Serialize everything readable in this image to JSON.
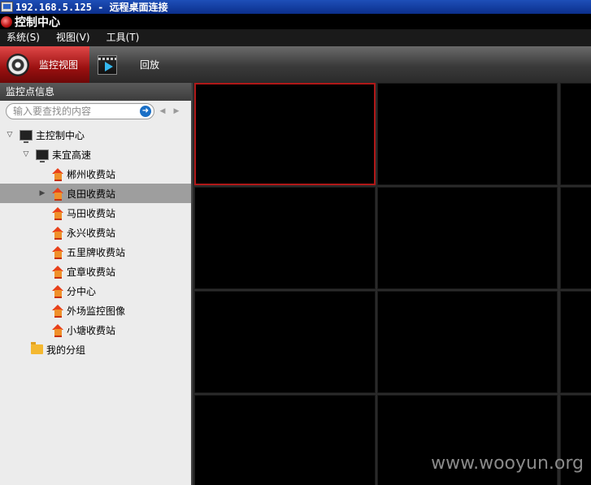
{
  "rdp": {
    "title": "192.168.5.125 - 远程桌面连接"
  },
  "app": {
    "title": "控制中心"
  },
  "menu": [
    "系统(S)",
    "视图(V)",
    "工具(T)"
  ],
  "toolbar": {
    "live_label": "监控视图",
    "playback_label": "回放"
  },
  "panel": {
    "header": "监控点信息",
    "search_placeholder": "输入要查找的内容"
  },
  "tree": [
    {
      "label": "主控制中心",
      "level": 0,
      "icon": "monitor-icon",
      "expander": "▽"
    },
    {
      "label": "耒宜高速",
      "level": 1,
      "icon": "monitor-icon",
      "expander": "▽"
    },
    {
      "label": "郴州收费站",
      "level": 2,
      "icon": "house-icon",
      "expander": ""
    },
    {
      "label": "良田收费站",
      "level": 2,
      "icon": "house-icon",
      "expander": "▶",
      "selected": true
    },
    {
      "label": "马田收费站",
      "level": 2,
      "icon": "house-icon",
      "expander": ""
    },
    {
      "label": "永兴收费站",
      "level": 2,
      "icon": "house-icon",
      "expander": ""
    },
    {
      "label": "五里牌收费站",
      "level": 2,
      "icon": "house-icon",
      "expander": ""
    },
    {
      "label": "宜章收费站",
      "level": 2,
      "icon": "house-icon",
      "expander": ""
    },
    {
      "label": "分中心",
      "level": 2,
      "icon": "house-icon",
      "expander": ""
    },
    {
      "label": "外场监控图像",
      "level": 2,
      "icon": "house-icon",
      "expander": ""
    },
    {
      "label": "小塘收费站",
      "level": 2,
      "icon": "house-icon",
      "expander": ""
    },
    {
      "label": "我的分组",
      "level": 0,
      "icon": "folder-icon",
      "expander": ""
    }
  ],
  "video_grid": {
    "rows": 4,
    "cols": 3,
    "active_cell": 0
  },
  "watermark": "www.wooyun.org"
}
